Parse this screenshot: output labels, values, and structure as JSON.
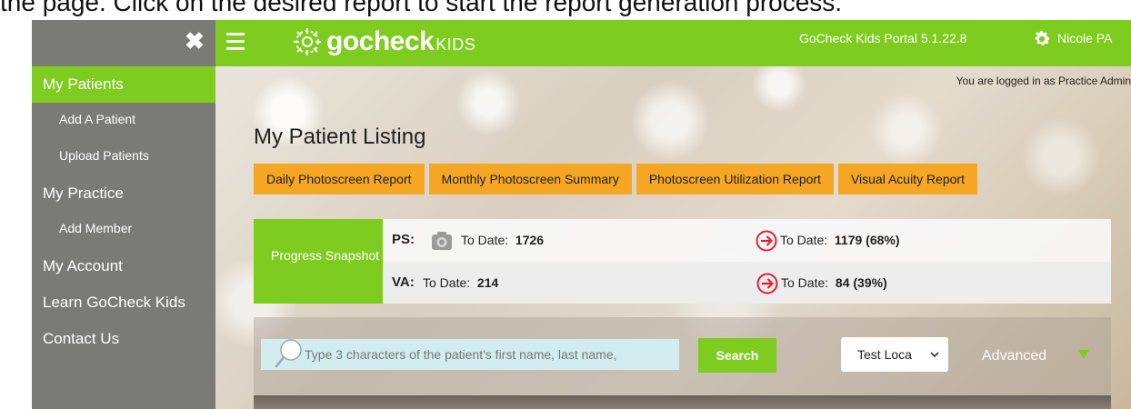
{
  "instruction": "the page. Click on the desired report to start the report generation process.",
  "sidebar": {
    "close_glyph": "✖",
    "items": [
      {
        "label": "My Patients",
        "level": 1,
        "active": true
      },
      {
        "label": "Add A Patient",
        "level": 2
      },
      {
        "label": "Upload Patients",
        "level": 2
      },
      {
        "label": "My Practice",
        "level": 1
      },
      {
        "label": "Add Member",
        "level": 2
      },
      {
        "label": "My Account",
        "level": 1
      },
      {
        "label": "Learn GoCheck Kids",
        "level": 1
      },
      {
        "label": "Contact Us",
        "level": 1
      }
    ]
  },
  "header": {
    "logo_main": "gocheck",
    "logo_sub": "KIDS",
    "portal_version": "GoCheck Kids Portal 5.1.22.8",
    "user_name": "Nicole PA"
  },
  "main": {
    "logged_in": "You are logged in as Practice Admin",
    "page_title": "My Patient Listing",
    "report_buttons": [
      "Daily Photoscreen Report",
      "Monthly Photoscreen Summary",
      "Photoscreen Utilization Report",
      "Visual Acuity Report"
    ],
    "snapshot": {
      "label": "Progress Snapshot",
      "ps": {
        "key": "PS:",
        "to_date_label": "To Date:",
        "to_date_value": "1726",
        "referred_label": "To Date:",
        "referred_value": "1179 (68%)"
      },
      "va": {
        "key": "VA:",
        "to_date_label": "To Date:",
        "to_date_value": "214",
        "referred_label": "To Date:",
        "referred_value": "84 (39%)"
      }
    },
    "search": {
      "placeholder": "Type 3 characters of the patient's first name, last name,",
      "button_label": "Search",
      "location_value": "Test Loca",
      "advanced_label": "Advanced"
    }
  },
  "colors": {
    "brand_green": "#7dcc1f",
    "report_orange": "#f5a623",
    "sidebar_gray": "#7a7a76",
    "alert_red": "#e5202e"
  }
}
